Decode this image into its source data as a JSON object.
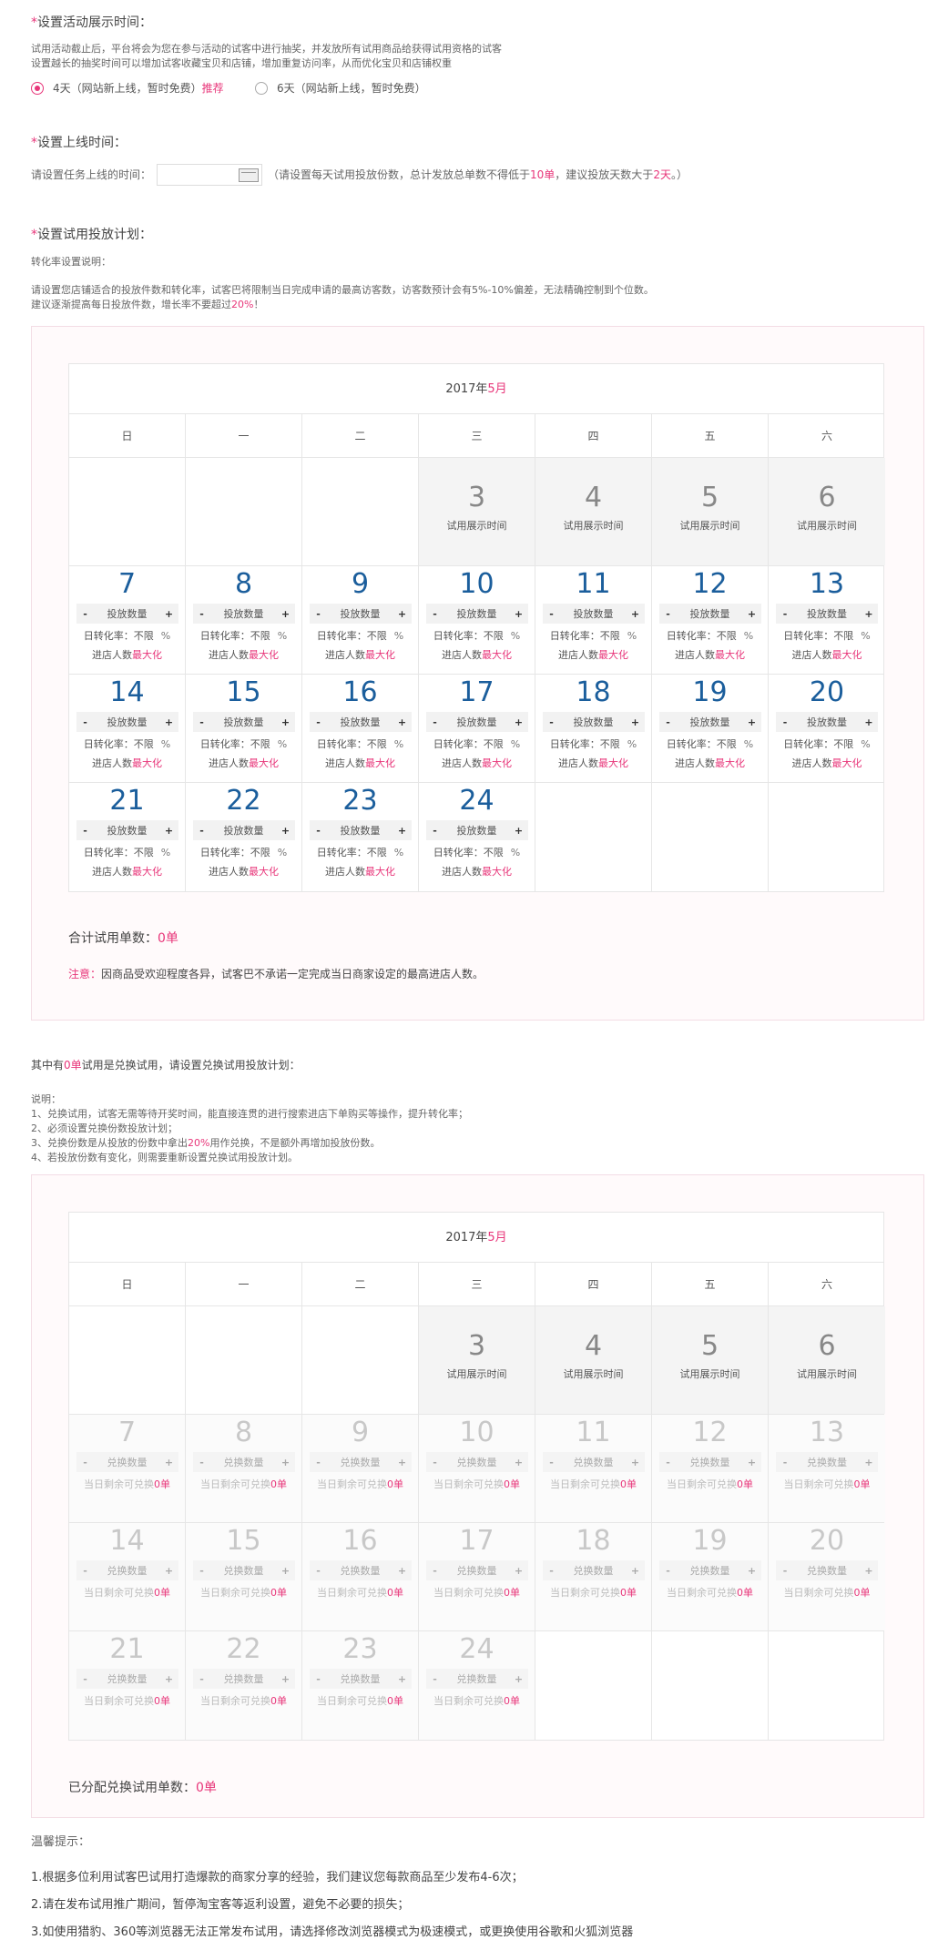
{
  "section1": {
    "heading": "设置活动展示时间：",
    "desc1": "试用活动截止后，平台将会为您在参与活动的试客中进行抽奖，并发放所有试用商品给获得试用资格的试客",
    "desc2": "设置越长的抽奖时间可以增加试客收藏宝贝和店铺，增加重复访问率，从而优化宝贝和店铺权重",
    "opt1_label": "4天（网站新上线，暂时免费）",
    "opt1_tag": "推荐",
    "opt2_label": "6天（网站新上线，暂时免费）"
  },
  "section2": {
    "heading": "设置上线时间：",
    "label": "请设置任务上线的时间：",
    "hint_a": "（请设置每天试用投放份数，总计发放总单数不得低于",
    "hint_b": "10单",
    "hint_c": "，建议投放天数大于",
    "hint_d": "2天",
    "hint_e": "。）"
  },
  "section3": {
    "heading": "设置试用投放计划：",
    "sublink": "转化率设置说明：",
    "desc1": "请设置您店铺适合的投放件数和转化率，试客巴将限制当日完成申请的最高访客数，访客数预计会有5%-10%偏差，无法精确控制到个位数。",
    "desc2a": "建议逐渐提高每日投放件数，增长率不要超过",
    "desc2b": "20%",
    "desc2c": "！"
  },
  "calendar": {
    "title_a": "2017年",
    "title_b": "5月",
    "weekdays": [
      "日",
      "一",
      "二",
      "三",
      "四",
      "五",
      "六"
    ],
    "show_days": [
      "3",
      "4",
      "5",
      "6"
    ],
    "show_label": "试用展示时间",
    "days": [
      "7",
      "8",
      "9",
      "10",
      "11",
      "12",
      "13",
      "14",
      "15",
      "16",
      "17",
      "18",
      "19",
      "20",
      "21",
      "22",
      "23",
      "24"
    ],
    "minus": "-",
    "plus": "+",
    "qty_label": "投放数量",
    "rate_label": "日转化率：不限",
    "rate_unit": "%",
    "visitors_label": "进店人数",
    "visitors_value": "最大化"
  },
  "total1": {
    "label": "合计试用单数：",
    "value": "0单"
  },
  "notice": {
    "label": "注意：",
    "text": "因商品受欢迎程度各异，试客巴不承诺一定完成当日商家设定的最高进店人数。"
  },
  "exchange": {
    "heading_a": "其中有",
    "heading_b": "0单",
    "heading_c": "试用是兑换试用，请设置兑换试用投放计划：",
    "desc_title": "说明：",
    "desc1": "1、兑换试用，试客无需等待开奖时间，能直接连贯的进行搜索进店下单购买等操作，提升转化率；",
    "desc2": "2、必须设置兑换份数投放计划；",
    "desc3a": "3、兑换份数是从投放的份数中拿出",
    "desc3b": "20%",
    "desc3c": "用作兑换，不是额外再增加投放份数。",
    "desc4": "4、若投放份数有变化，则需要重新设置兑换试用投放计划。",
    "qty_label": "兑换数量",
    "remain_label": "当日剩余可兑换",
    "remain_value": "0单"
  },
  "total2": {
    "label": "已分配兑换试用单数：",
    "value": "0单"
  },
  "tips": {
    "title": "温馨提示：",
    "items": [
      "1.根据多位利用试客巴试用打造爆款的商家分享的经验，我们建议您每款商品至少发布4-6次；",
      "2.请在发布试用推广期间，暂停淘宝客等返利设置，避免不必要的损失；",
      "3.如使用猎豹、360等浏览器无法正常发布试用，请选择修改浏览器模式为极速模式，或更换使用谷歌和火狐浏览器"
    ]
  },
  "colors": {
    "accent": "#e8367a",
    "day_number": "#1b5e9c"
  }
}
